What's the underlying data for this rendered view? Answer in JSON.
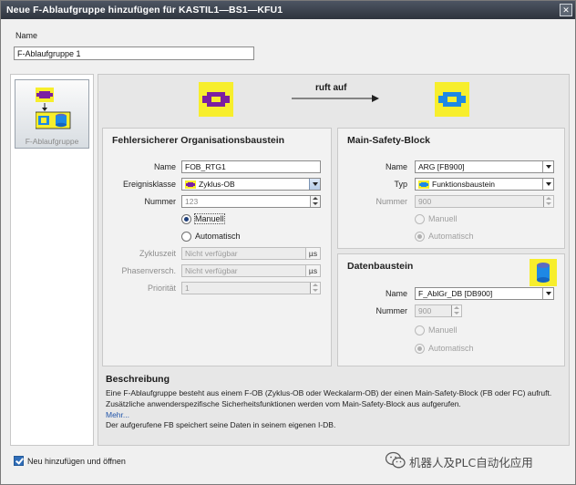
{
  "window": {
    "title": "Neue F-Ablaufgruppe hinzufügen für KASTIL1—BS1—KFU1",
    "close": "✕"
  },
  "name_section": {
    "label": "Name",
    "value": "F-Ablaufgruppe 1"
  },
  "left_tile": {
    "label": "F-Ablaufgruppe"
  },
  "diagram": {
    "calls_label": "ruft auf"
  },
  "fob": {
    "title": "Fehlersicherer Organisationsbaustein",
    "name_label": "Name",
    "name_value": "FOB_RTG1",
    "class_label": "Ereignisklasse",
    "class_value": "Zyklus-OB",
    "number_label": "Nummer",
    "number_value": "123",
    "radio_manual": "Manuell",
    "radio_auto": "Automatisch",
    "cycle_label": "Zykluszeit",
    "cycle_value": "Nicht verfügbar",
    "cycle_unit": "µs",
    "phase_label": "Phasenversch.",
    "phase_value": "Nicht verfügbar",
    "phase_unit": "µs",
    "prio_label": "Priorität",
    "prio_value": "1"
  },
  "msb": {
    "title": "Main-Safety-Block",
    "name_label": "Name",
    "name_value": "ARG [FB900]",
    "type_label": "Typ",
    "type_value": "Funktionsbaustein",
    "number_label": "Nummer",
    "number_value": "900",
    "radio_manual": "Manuell",
    "radio_auto": "Automatisch"
  },
  "db": {
    "title": "Datenbaustein",
    "name_label": "Name",
    "name_value": "F_AblGr_DB [DB900]",
    "number_label": "Nummer",
    "number_value": "900",
    "radio_manual": "Manuell",
    "radio_auto": "Automatisch"
  },
  "description": {
    "title": "Beschreibung",
    "text": "Eine F-Ablaufgruppe besteht aus einem F-OB (Zyklus-OB oder Weckalarm-OB) der einen Main-Safety-Block (FB oder FC) aufruft. Zusätzliche anwenderspezifische Sicherheitsfunktionen werden vom Main-Safety-Block aus aufgerufen.",
    "more": "Mehr...",
    "text2": "Der aufgerufene FB speichert seine Daten in seinem eigenen I-DB."
  },
  "footer": {
    "add_open_label": "Neu hinzufügen und öffnen",
    "add_open_checked": true
  },
  "watermark": {
    "text": "机器人及PLC自动化应用"
  }
}
